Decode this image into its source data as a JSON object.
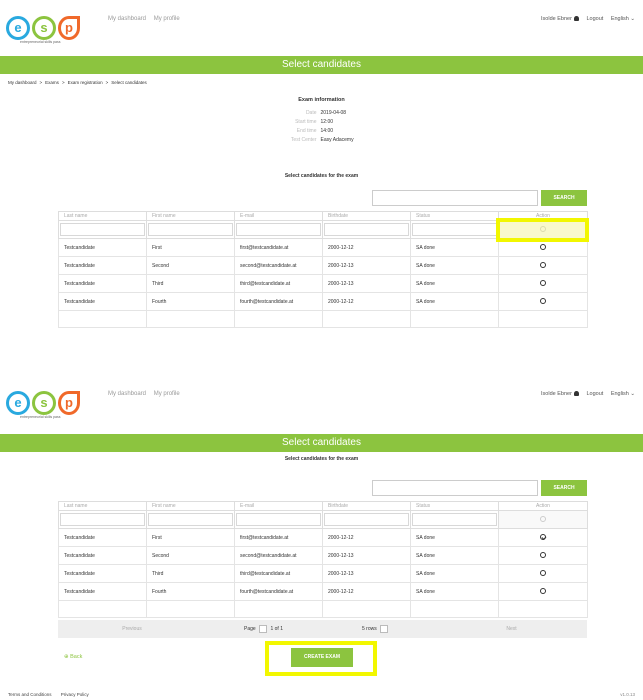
{
  "colors": {
    "accent": "#8cc43f",
    "logo_e": "#29a9df",
    "logo_s": "#8cc43f",
    "logo_p": "#f0692a",
    "highlight": "#f2f700"
  },
  "logo": {
    "letters": [
      "e",
      "s",
      "p"
    ],
    "tagline": "entrepreneurial skills pass"
  },
  "nav": {
    "dashboard": "My dashboard",
    "profile": "My profile"
  },
  "user": {
    "name": "Isolde Ebner",
    "logout": "Logout",
    "language": "English"
  },
  "page_title": "Select candidates",
  "breadcrumb": [
    "My dashboard",
    ">",
    "Exams",
    ">",
    "Exam registration",
    ">",
    "Select candidates"
  ],
  "exam_info": {
    "heading": "Exam information",
    "rows": [
      {
        "label": "Date",
        "value": "2019-04-08"
      },
      {
        "label": "Start time",
        "value": "12:00"
      },
      {
        "label": "End time",
        "value": "14:00"
      },
      {
        "label": "Test Center",
        "value": "Easy Adacemy"
      }
    ]
  },
  "select_heading": "Select candidates for the exam",
  "search": {
    "button": "SEARCH",
    "value": ""
  },
  "table": {
    "headers": [
      "Last name",
      "First name",
      "E-mail",
      "Birthdate",
      "Status",
      "Action"
    ],
    "rows": [
      [
        "Testcandidate",
        "First",
        "first@testcandidate.at",
        "2000-12-12",
        "SA done"
      ],
      [
        "Testcandidate",
        "Second",
        "second@testcandidate.at",
        "2000-12-13",
        "SA done"
      ],
      [
        "Testcandidate",
        "Third",
        "third@testcandidate.at",
        "2000-12-13",
        "SA done"
      ],
      [
        "Testcandidate",
        "Fourth",
        "fourth@testcandidate.at",
        "2000-12-12",
        "SA done"
      ]
    ],
    "selected_row_bottom_panel": 0
  },
  "pagination": {
    "previous": "Previous",
    "page_label": "Page",
    "page_value": "1",
    "of_label": "of 1",
    "rows_option": "5 rows",
    "next": "Next"
  },
  "back": "Back",
  "create_exam": "CREATE EXAM",
  "footer": {
    "terms": "Terms and Conditions",
    "privacy": "Privacy Policy",
    "version": "v1.0.13"
  }
}
